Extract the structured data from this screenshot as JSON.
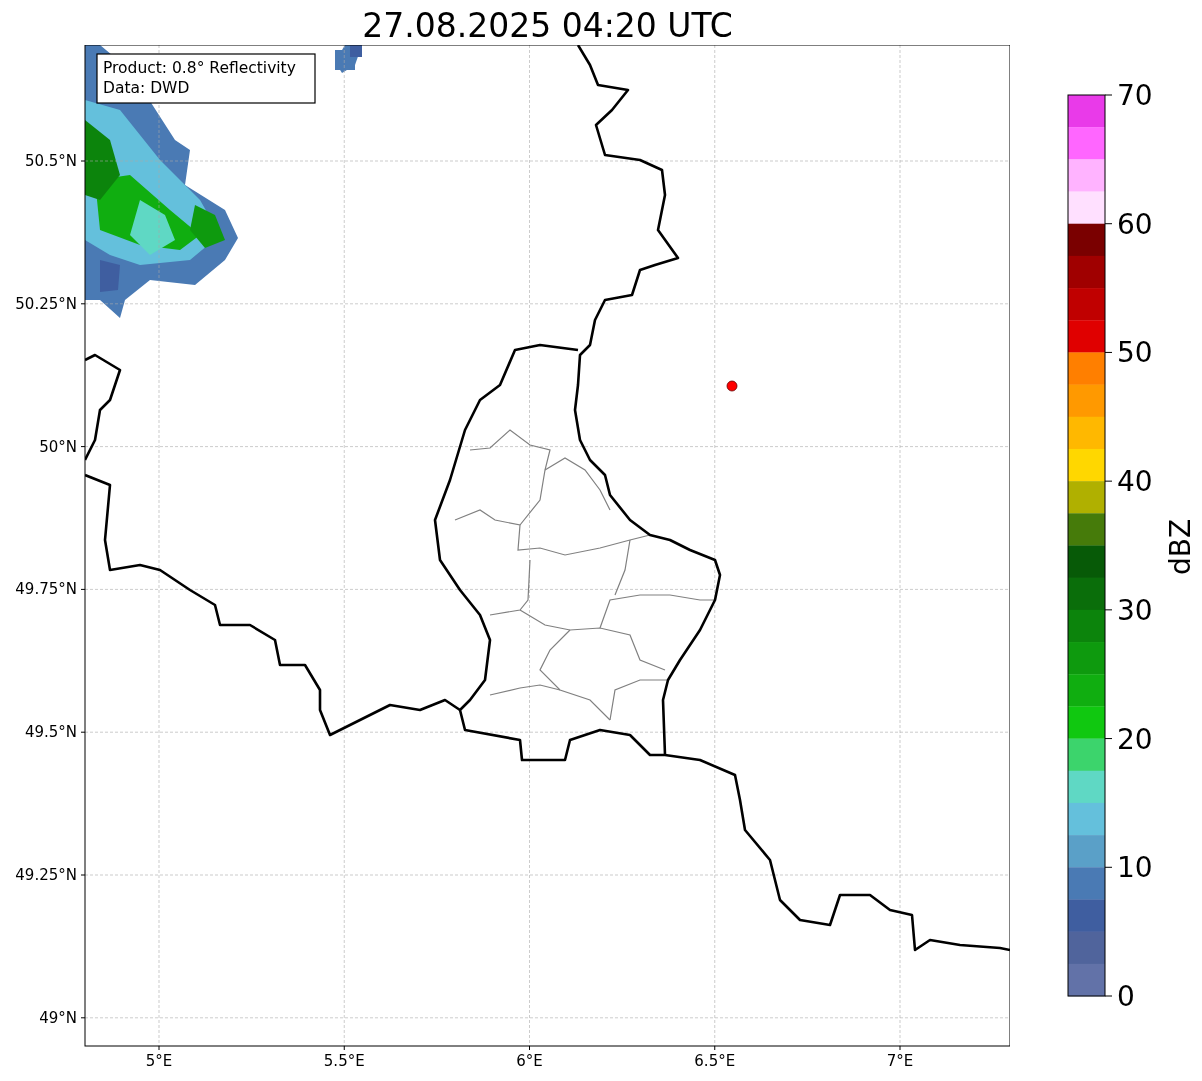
{
  "title": "27.08.2025 04:20 UTC",
  "map": {
    "info_box": [
      "Product: 0.8° Reflectivity",
      "Data: DWD"
    ],
    "lat_labels": [
      "50.5°N",
      "50.25°N",
      "50°N",
      "49.75°N",
      "49.5°N",
      "49.25°N",
      "49°N"
    ],
    "lon_labels": [
      "5°E",
      "5.5°E",
      "6°E",
      "6.5°E",
      "7°E"
    ]
  },
  "colorbar": {
    "label": "dBZ",
    "tick_labels": [
      "70",
      "60",
      "50",
      "40",
      "30",
      "20",
      "10",
      "0"
    ],
    "segments": [
      {
        "color": "#e93ae9"
      },
      {
        "color": "#ff66ff"
      },
      {
        "color": "#ffb3ff"
      },
      {
        "color": "#ffe0ff"
      },
      {
        "color": "#7a0000"
      },
      {
        "color": "#a00000"
      },
      {
        "color": "#c00000"
      },
      {
        "color": "#e00000"
      },
      {
        "color": "#ff7f00"
      },
      {
        "color": "#ff9900"
      },
      {
        "color": "#ffb800"
      },
      {
        "color": "#ffd700"
      },
      {
        "color": "#b0b000"
      },
      {
        "color": "#467b0a"
      },
      {
        "color": "#075a07"
      },
      {
        "color": "#0a6e0a"
      },
      {
        "color": "#0c840c"
      },
      {
        "color": "#0e9a0e"
      },
      {
        "color": "#10ae10"
      },
      {
        "color": "#10c810"
      },
      {
        "color": "#3cd46c"
      },
      {
        "color": "#5fd8c4"
      },
      {
        "color": "#64c0dc"
      },
      {
        "color": "#5aa0c8"
      },
      {
        "color": "#4a7ab4"
      },
      {
        "color": "#3f5ea0"
      },
      {
        "color": "#50649c"
      },
      {
        "color": "#6272a8"
      }
    ]
  }
}
